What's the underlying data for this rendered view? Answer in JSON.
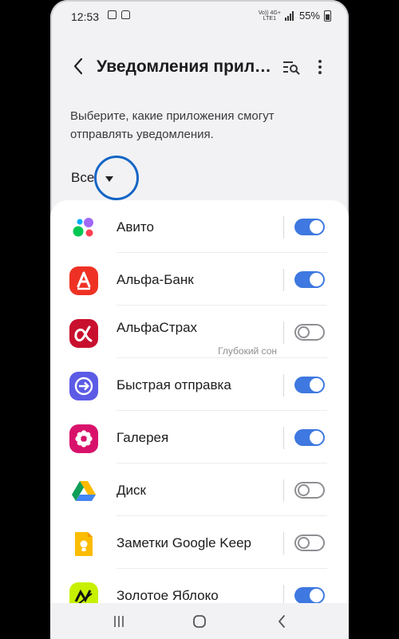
{
  "status_bar": {
    "time": "12:53",
    "network_top": "Vo)) 4G+",
    "network_bottom": "LTE1",
    "battery": "55%"
  },
  "app_bar": {
    "title": "Уведомления прило...",
    "back_icon": "chevron-left-icon",
    "search_icon": "search-list-icon",
    "more_icon": "more-vertical-icon"
  },
  "description": "Выберите, какие приложения смогут отправлять уведомления.",
  "filter": {
    "value": "Все",
    "highlight_color": "#1465c6"
  },
  "apps": [
    {
      "name": "Авито",
      "subtitle": "",
      "enabled": true,
      "icon": "avito-icon"
    },
    {
      "name": "Альфа-Банк",
      "subtitle": "",
      "enabled": true,
      "icon": "alfa-bank-icon"
    },
    {
      "name": "АльфаСтрах",
      "subtitle": "Глубокий сон",
      "enabled": false,
      "icon": "alfastrah-icon"
    },
    {
      "name": "Быстрая отправка",
      "subtitle": "",
      "enabled": true,
      "icon": "quick-share-icon"
    },
    {
      "name": "Галерея",
      "subtitle": "",
      "enabled": true,
      "icon": "gallery-icon"
    },
    {
      "name": "Диск",
      "subtitle": "",
      "enabled": false,
      "icon": "google-drive-icon"
    },
    {
      "name": "Заметки Google Keep",
      "subtitle": "",
      "enabled": false,
      "icon": "google-keep-icon"
    },
    {
      "name": "Золотое Яблоко",
      "subtitle": "",
      "enabled": true,
      "icon": "zolotoe-yabloko-icon"
    }
  ],
  "colors": {
    "toggle_on": "#3e78e0",
    "toggle_off": "#8e8e93"
  },
  "nav_bar": {
    "recent": "recent-apps-icon",
    "home": "home-icon",
    "back": "back-icon"
  }
}
